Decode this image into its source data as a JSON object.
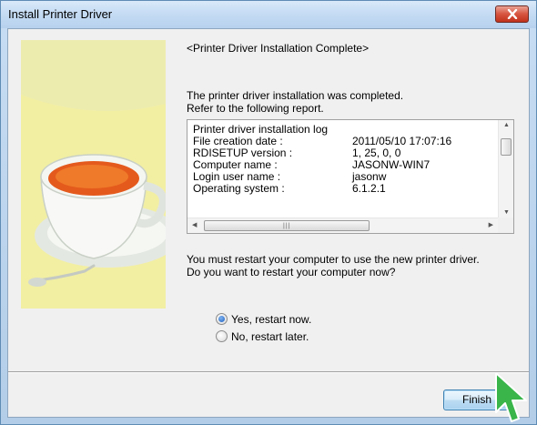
{
  "window": {
    "title": "Install Printer Driver"
  },
  "page": {
    "heading": "<Printer Driver Installation Complete>",
    "intro_lines": [
      "The printer driver installation was completed.",
      "Refer to the following report."
    ]
  },
  "report": {
    "title": "Printer driver installation log",
    "rows": [
      {
        "label": "File creation date :",
        "value": "2011/05/10 17:07:16"
      },
      {
        "label": "RDISETUP version :",
        "value": "1, 25, 0, 0"
      },
      {
        "label": "Computer name :",
        "value": "JASONW-WIN7"
      },
      {
        "label": "Login user name :",
        "value": "jasonw"
      },
      {
        "label": "Operating system :",
        "value": "6.1.2.1"
      }
    ]
  },
  "restart": {
    "lines": [
      "You must restart your computer to use the new printer driver.",
      "Do you want to restart your computer now?"
    ],
    "options": [
      {
        "label": "Yes, restart now.",
        "checked": true
      },
      {
        "label": "No, restart later.",
        "checked": false
      }
    ]
  },
  "buttons": {
    "finish": "Finish"
  },
  "colors": {
    "title_bar": "#c4dbf3",
    "close_button": "#d7543f",
    "art_background": "#f3f0a6",
    "cursor": "#39b54a"
  },
  "icons": {
    "close": "close-icon",
    "cursor": "pointer-cursor-icon"
  }
}
